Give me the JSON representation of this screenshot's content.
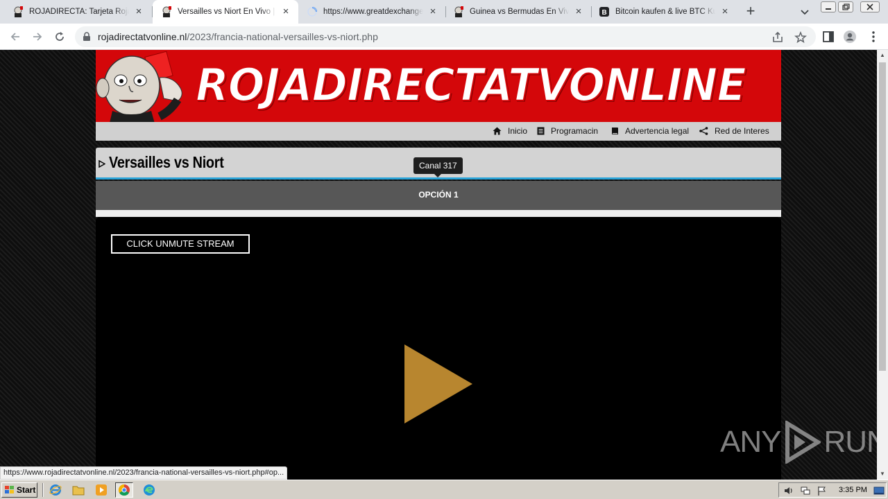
{
  "browser": {
    "tabs": [
      {
        "title": "ROJADIRECTA: Tarjeta Roja TV",
        "icon": "mascot-favicon",
        "active": false
      },
      {
        "title": "Versailles vs Niort En Vivo | Francia",
        "icon": "mascot-favicon",
        "active": true
      },
      {
        "title": "https://www.greatdexchange.com",
        "icon": "loading-spinner",
        "active": false
      },
      {
        "title": "Guinea vs Bermudas En Vivo | Rojadirecta",
        "icon": "mascot-favicon",
        "active": false
      },
      {
        "title": "Bitcoin kaufen & live BTC Kurs | Bitpanda",
        "icon": "bitpanda-favicon",
        "active": false
      }
    ],
    "new_tab_label": "+",
    "url_host": "rojadirectatvonline.nl",
    "url_path": "/2023/francia-national-versailles-vs-niort.php"
  },
  "site": {
    "logo_text": "ROJADIRECTATVONLINE",
    "nav": [
      {
        "label": "Inicio",
        "icon": "home-icon"
      },
      {
        "label": "Programacin",
        "icon": "schedule-icon"
      },
      {
        "label": "Advertencia legal",
        "icon": "book-icon"
      },
      {
        "label": "Red de Interes",
        "icon": "share-icon"
      }
    ],
    "match_title": "Versailles vs Niort",
    "tooltip": "Canal 317",
    "option_label": "OPCIÓN 1",
    "unmute_label": "CLICK UNMUTE STREAM",
    "accent_color": "#d4070a",
    "play_color": "#b8862f"
  },
  "watermark": {
    "left": "ANY",
    "right": "RUN"
  },
  "status_url": "https://www.rojadirectatvonline.nl/2023/francia-national-versailles-vs-niort.php#op...",
  "taskbar": {
    "start_label": "Start",
    "clock": "3:35 PM"
  }
}
